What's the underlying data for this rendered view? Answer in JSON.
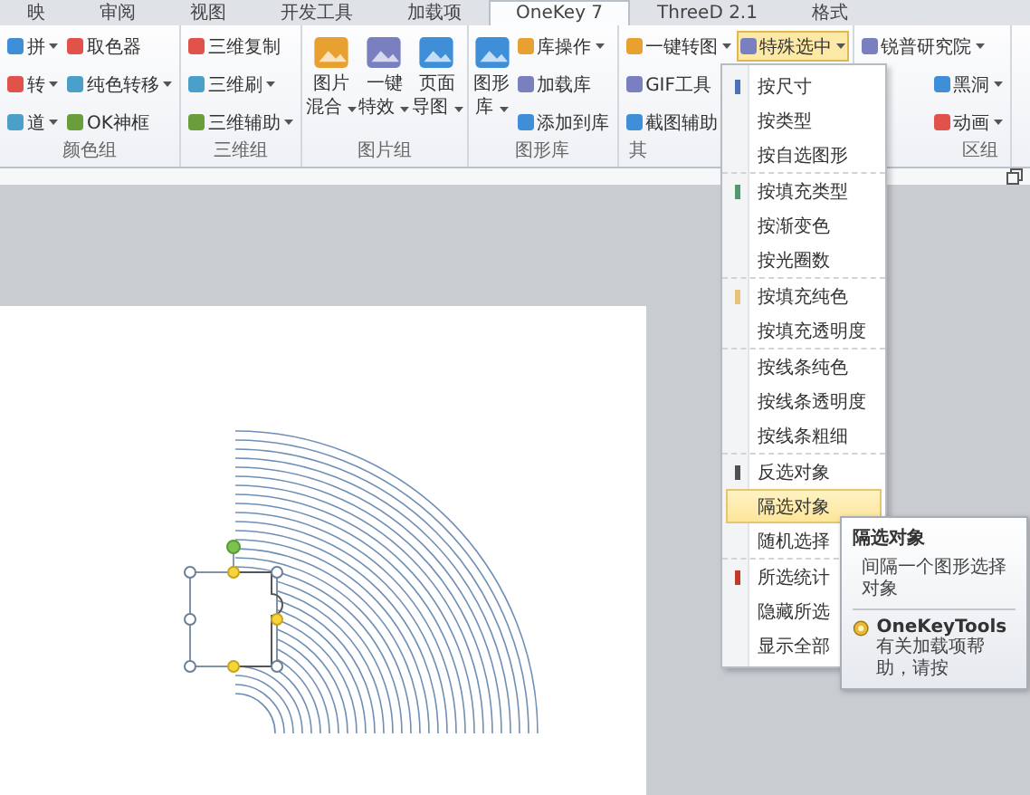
{
  "tabs": [
    {
      "label": "映",
      "selected": false
    },
    {
      "label": "审阅",
      "selected": false
    },
    {
      "label": "视图",
      "selected": false
    },
    {
      "label": "开发工具",
      "selected": false
    },
    {
      "label": "加载项",
      "selected": false
    },
    {
      "label": "OneKey 7",
      "selected": true
    },
    {
      "label": "ThreeD 2.1",
      "selected": false
    },
    {
      "label": "格式",
      "selected": false
    }
  ],
  "ribbon": {
    "groups": [
      {
        "label": "颜色组",
        "columns": [
          {
            "kind": "small",
            "items": [
              {
                "label": "拼",
                "dropdown": true
              },
              {
                "label": "转",
                "dropdown": true
              },
              {
                "label": "道",
                "dropdown": true
              }
            ]
          },
          {
            "kind": "small",
            "items": [
              {
                "label": "取色器",
                "dropdown": false
              },
              {
                "label": "纯色转移",
                "dropdown": true
              },
              {
                "label": "OK神框",
                "dropdown": false
              }
            ]
          }
        ]
      },
      {
        "label": "三维组",
        "columns": [
          {
            "kind": "small",
            "items": [
              {
                "label": "三维复制",
                "dropdown": false
              },
              {
                "label": "三维刷",
                "dropdown": true
              },
              {
                "label": "三维辅助",
                "dropdown": true
              }
            ]
          }
        ]
      },
      {
        "label": "图片组",
        "columns": [
          {
            "kind": "large",
            "items": [
              {
                "lines": [
                  "图片",
                  "混合"
                ],
                "dropdown": true
              }
            ]
          },
          {
            "kind": "large",
            "items": [
              {
                "lines": [
                  "一键",
                  "特效"
                ],
                "dropdown": true
              }
            ]
          },
          {
            "kind": "large",
            "items": [
              {
                "lines": [
                  "页面",
                  "导图"
                ],
                "dropdown": true
              }
            ]
          }
        ]
      },
      {
        "label": "图形库",
        "columns": [
          {
            "kind": "large",
            "items": [
              {
                "lines": [
                  "图形",
                  "库"
                ],
                "dropdown": true
              }
            ]
          },
          {
            "kind": "small",
            "items": [
              {
                "label": "库操作",
                "dropdown": true
              },
              {
                "label": "加载库",
                "dropdown": false
              },
              {
                "label": "添加到库",
                "dropdown": false
              }
            ]
          }
        ]
      },
      {
        "label": "其",
        "columns": [
          {
            "kind": "small",
            "items": [
              {
                "label": "一键转图",
                "dropdown": true
              },
              {
                "label": "GIF工具",
                "dropdown": false
              },
              {
                "label": "截图辅助",
                "dropdown": false
              }
            ]
          },
          {
            "kind": "small",
            "items": [
              {
                "label": "特殊选中",
                "dropdown": true,
                "selected": true
              }
            ]
          }
        ]
      },
      {
        "label": "区组",
        "columns": [
          {
            "kind": "small",
            "items": [
              {
                "label": "锐普研究院",
                "dropdown": true
              },
              {
                "label": "黑洞",
                "dropdown": true
              },
              {
                "label": "动画",
                "dropdown": true
              }
            ]
          }
        ]
      }
    ]
  },
  "menu": {
    "sections": [
      [
        {
          "label": "按尺寸",
          "color": "#4a72b8",
          "selected": false
        },
        {
          "label": "按类型",
          "selected": false
        },
        {
          "label": "按自选图形",
          "selected": false
        }
      ],
      [
        {
          "label": "按填充类型",
          "color": "#4f9a6c",
          "selected": false
        },
        {
          "label": "按渐变色",
          "selected": false
        },
        {
          "label": "按光圈数",
          "selected": false
        }
      ],
      [
        {
          "label": "按填充纯色",
          "color": "#e9c27a",
          "selected": false
        },
        {
          "label": "按填充透明度",
          "selected": false
        }
      ],
      [
        {
          "label": "按线条纯色",
          "selected": false
        },
        {
          "label": "按线条透明度",
          "selected": false
        },
        {
          "label": "按线条粗细",
          "selected": false
        }
      ],
      [
        {
          "label": "反选对象",
          "color": "#505050",
          "selected": false
        },
        {
          "label": "隔选对象",
          "selected": true
        },
        {
          "label": "随机选择",
          "selected": false
        }
      ],
      [
        {
          "label": "所选统计",
          "color": "#c0392b",
          "selected": false
        },
        {
          "label": "隐藏所选",
          "selected": false
        },
        {
          "label": "显示全部",
          "selected": false
        }
      ]
    ]
  },
  "tooltip": {
    "title": "隔选对象",
    "description": "间隔一个图形选择对象",
    "addin": "OneKeyTools",
    "help": "有关加载项帮助，请按"
  }
}
